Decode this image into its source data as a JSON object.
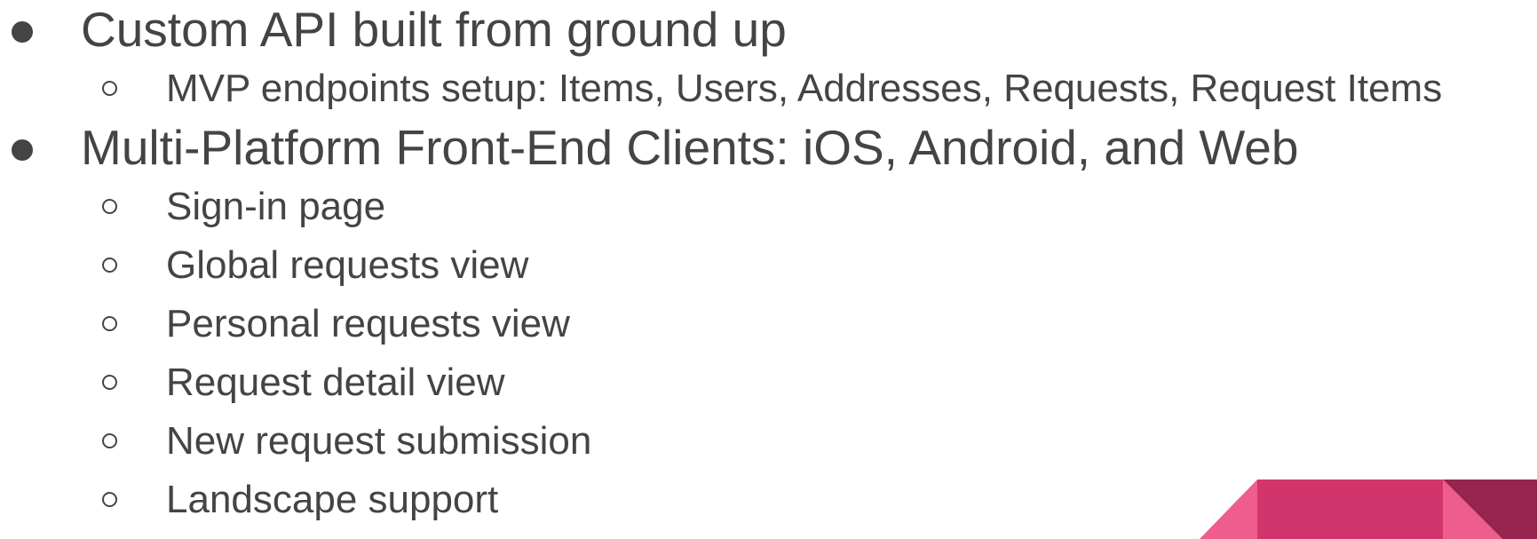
{
  "bullets": [
    {
      "text": "Custom API built from ground up",
      "children": [
        "MVP endpoints setup: Items, Users, Addresses, Requests, Request Items"
      ]
    },
    {
      "text": "Multi-Platform Front-End Clients: iOS, Android, and Web",
      "children": [
        "Sign-in page",
        "Global requests view",
        "Personal requests view",
        "Request detail view",
        "New request submission",
        "Landscape support"
      ]
    }
  ],
  "colors": {
    "text": "#444444",
    "accent_light": "#ee5d8d",
    "accent_mid": "#d2356b",
    "accent_dark": "#96244d"
  }
}
